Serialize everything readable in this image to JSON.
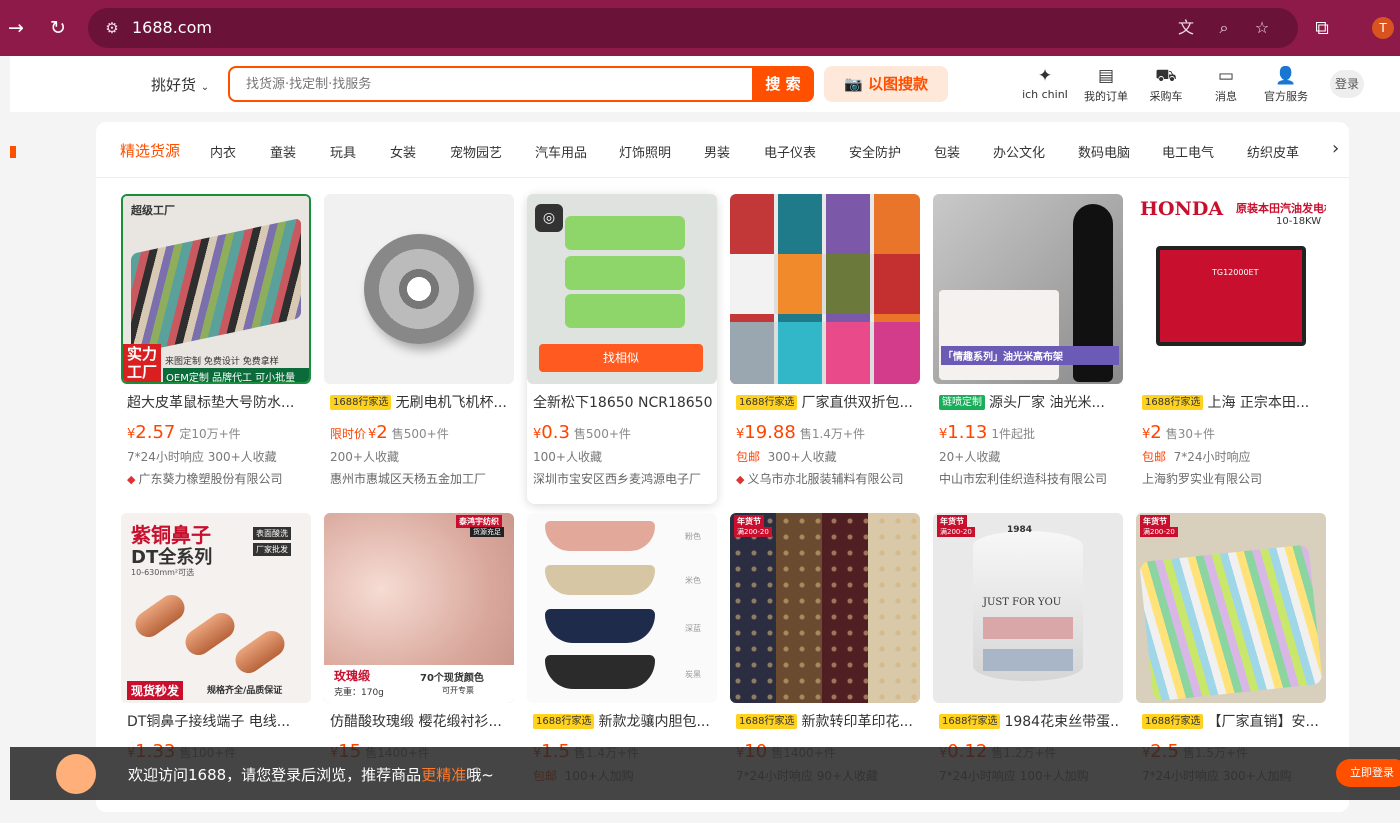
{
  "browser": {
    "url": "1688.com",
    "avatar": "T"
  },
  "header": {
    "pick_label": "挑好货",
    "search_placeholder": "找货源·找定制·找服务",
    "search_button": "搜 索",
    "image_search": "以图搜款",
    "nav": [
      {
        "icon": "puzzle-icon",
        "label": "ich chinI"
      },
      {
        "icon": "order-icon",
        "label": "我的订单"
      },
      {
        "icon": "cart-icon",
        "label": "采购车"
      },
      {
        "icon": "message-icon",
        "label": "消息"
      },
      {
        "icon": "service-icon",
        "label": "官方服务"
      }
    ],
    "login": "登录"
  },
  "categories": [
    "精选货源",
    "内衣",
    "童装",
    "玩具",
    "女装",
    "宠物园艺",
    "汽车用品",
    "灯饰照明",
    "男装",
    "电子仪表",
    "安全防护",
    "包装",
    "办公文化",
    "数码电脑",
    "电工电气",
    "纺织皮革"
  ],
  "products": [
    {
      "title": "超大皮革鼠标垫大号防水...",
      "tag": "",
      "prefix": "",
      "price": "2.57",
      "sold": "定10万+件",
      "l1": "7*24小时响应  300+人收藏",
      "l1_red": "",
      "shop": "广东葵力橡塑股份有限公司",
      "img": "img1"
    },
    {
      "title": "无刷电机飞机杯...",
      "tag": "1688行家选",
      "tag_type": "y",
      "prefix": "限时价",
      "price": "2",
      "sold": "售500+件",
      "l1": "200+人收藏",
      "l1_red": "",
      "shop": "惠州市惠城区天杨五金加工厂",
      "img": "img2"
    },
    {
      "title": "全新松下18650 NCR18650...",
      "tag": "",
      "prefix": "",
      "price": "0.3",
      "sold": "售500+件",
      "l1": "100+人收藏",
      "l1_red": "",
      "shop": "深圳市宝安区西乡麦鸿源电子厂",
      "img": "img3",
      "find_similar": "找相似"
    },
    {
      "title": "厂家直供双折包...",
      "tag": "1688行家选",
      "tag_type": "y",
      "prefix": "",
      "price": "19.88",
      "sold": "售1.4万+件",
      "l1": "300+人收藏",
      "l1_red": "包邮",
      "shop": "义乌市亦北服装辅料有限公司",
      "img": "img4"
    },
    {
      "title": "源头厂家 油光米...",
      "tag": "链喷定制",
      "tag_type": "g",
      "prefix": "",
      "price": "1.13",
      "sold": "1件起批",
      "l1": "20+人收藏",
      "l1_red": "",
      "shop": "中山市宏利佳织造科技有限公司",
      "img": "img5"
    },
    {
      "title": "上海 正宗本田...",
      "tag": "1688行家选",
      "tag_type": "y",
      "prefix": "",
      "price": "2",
      "sold": "售30+件",
      "l1": "7*24小时响应",
      "l1_red": "包邮",
      "shop": "上海豹罗实业有限公司",
      "img": "img6"
    },
    {
      "title": "DT铜鼻子接线端子 电线...",
      "tag": "",
      "prefix": "",
      "price": "1.33",
      "sold": "售100+件",
      "l1": "",
      "l1_red": "",
      "shop": "",
      "img": "img7"
    },
    {
      "title": "仿醋酸玫瑰缎 樱花缎衬衫...",
      "tag": "",
      "prefix": "",
      "price": "15",
      "sold": "售1400+件",
      "l1": "",
      "l1_red": "",
      "shop": "",
      "img": "img8"
    },
    {
      "title": "新款龙骧内胆包...",
      "tag": "1688行家选",
      "tag_type": "y",
      "prefix": "",
      "price": "1.5",
      "sold": "售1.4万+件",
      "l1": "100+人加购",
      "l1_red": "包邮",
      "shop": "",
      "img": "img9"
    },
    {
      "title": "新款转印革印花...",
      "tag": "1688行家选",
      "tag_type": "y",
      "prefix": "",
      "price": "10",
      "sold": "售1400+件",
      "l1": "7*24小时响应  90+人收藏",
      "l1_red": "",
      "shop": "",
      "img": "img10"
    },
    {
      "title": "1984花束丝带蛋...",
      "tag": "1688行家选",
      "tag_type": "y",
      "prefix": "",
      "price": "0.12",
      "sold": "售1.2万+件",
      "l1": "7*24小时响应  100+人加购",
      "l1_red": "",
      "shop": "",
      "img": "img11"
    },
    {
      "title": "【厂家直销】安...",
      "tag": "1688行家选",
      "tag_type": "y",
      "prefix": "",
      "price": "2.5",
      "sold": "售1.5万+件",
      "l1": "7*24小时响应  300+人加购",
      "l1_red": "",
      "shop": "",
      "img": "img12"
    }
  ],
  "overlays": {
    "p1_badge": "超级工厂",
    "p1_big1": "实力",
    "p1_big2": "工厂",
    "p1_s1": "来图定制 免费设计 免费拿样",
    "p1_s2": "OEM定制 品牌代工 可小批量",
    "p5_title": "「情趣系列」油光米高布架",
    "p6_brand": "HONDA",
    "p6_title": "原装本田汽油发电机",
    "p6_sub": "10-18KW",
    "p6_model": "TG12000ET",
    "p7_t1": "紫铜鼻子",
    "p7_t2": "DT全系列",
    "p7_t3": "10-630mm²可选",
    "p7_b1": "现货秒发",
    "p7_b2": "规格齐全/品质保证",
    "p7_c1": "表面酸洗",
    "p7_c2": "厂家批发",
    "p8_badge": "泰鸿宇纺织",
    "p8_badge2": "货源充足",
    "p8_t1": "玫瑰缎",
    "p8_t2": "克重：170g",
    "p8_t3": "70个现货颜色",
    "p8_t4": "可开专票",
    "p9_colors": [
      "粉色",
      "米色",
      "深蓝",
      "炭黑"
    ],
    "p10_badge": "年货节",
    "p10_sub": "满200-20",
    "p11_brand": "1984",
    "p11_ribbon": "JUST FOR YOU",
    "p12_badge": "年货节",
    "p12_sub": "满200-20"
  },
  "footer": {
    "text1": "欢迎访问1688，请您登录后浏览，推荐商品",
    "highlight": "更精准",
    "text2": "哦~",
    "button": "立即登录"
  },
  "colors": {
    "brand": "#ff5000",
    "browser": "#8e1a4a"
  }
}
